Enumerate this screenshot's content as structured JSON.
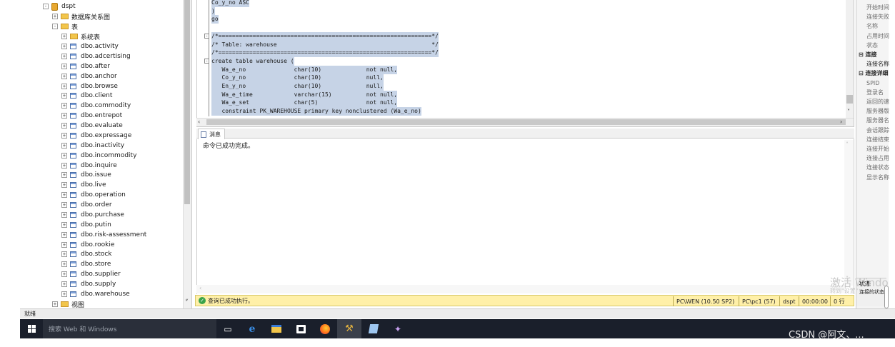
{
  "explorer": {
    "database": "dspt",
    "db_diagrams": "数据库关系图",
    "tables_folder": "表",
    "system_tables": "系统表",
    "tables": [
      "dbo.activity",
      "dbo.adcertising",
      "dbo.after",
      "dbo.anchor",
      "dbo.browse",
      "dbo.client",
      "dbo.commodity",
      "dbo.entrepot",
      "dbo.evaluate",
      "dbo.expressage",
      "dbo.inactivity",
      "dbo.incommodity",
      "dbo.inquire",
      "dbo.issue",
      "dbo.live",
      "dbo.operation",
      "dbo.order",
      "dbo.purchase",
      "dbo.putin",
      "dbo.risk-assessment",
      "dbo.rookie",
      "dbo.stock",
      "dbo.store",
      "dbo.supplier",
      "dbo.supply",
      "dbo.warehouse"
    ],
    "views_folder": "视图"
  },
  "editor": {
    "lines": [
      "Co_y_no ASC",
      ")",
      "go",
      "",
      "/*==============================================================*/",
      "/* Table: warehouse                                             */",
      "/*==============================================================*/",
      "create table warehouse (",
      "   Wa_e_no              char(10)             not null,",
      "   Co_y_no              char(10)             null,",
      "   En_y_no              char(10)             null,",
      "   Wa_e_time            varchar(15)          not null,",
      "   Wa_e_set             char(5)              not null,",
      "   constraint PK_WAREHOUSE primary key nonclustered (Wa_e_no)"
    ]
  },
  "messages": {
    "tab_label": "消息",
    "text": "命令已成功完成。"
  },
  "statusbar": {
    "message": "查询已成功执行。",
    "server": "PC\\WEN (10.50 SP2)",
    "user": "PC\\pc1 (57)",
    "database": "dspt",
    "elapsed": "00:00:00",
    "rows": "0 行"
  },
  "properties": {
    "items": [
      {
        "text": "开始时间",
        "kind": "item"
      },
      {
        "text": "连接失败",
        "kind": "item"
      },
      {
        "text": "名称",
        "kind": "item"
      },
      {
        "text": "占用时间",
        "kind": "item"
      },
      {
        "text": "状态",
        "kind": "item"
      },
      {
        "text": "连接",
        "kind": "header"
      },
      {
        "text": "连接名称",
        "kind": "dark"
      },
      {
        "text": "连接详细",
        "kind": "header"
      },
      {
        "text": "SPID",
        "kind": "item"
      },
      {
        "text": "登录名",
        "kind": "item"
      },
      {
        "text": "返回的速",
        "kind": "item"
      },
      {
        "text": "服务器版",
        "kind": "item"
      },
      {
        "text": "服务器名",
        "kind": "item"
      },
      {
        "text": "会话跟踪",
        "kind": "item"
      },
      {
        "text": "连接结束",
        "kind": "item"
      },
      {
        "text": "连接开始",
        "kind": "item"
      },
      {
        "text": "连接占用",
        "kind": "item"
      },
      {
        "text": "连接状态",
        "kind": "item"
      },
      {
        "text": "显示名称",
        "kind": "item"
      }
    ],
    "footer_title": "状态",
    "footer_desc": "连接的状态",
    "watermark_big": "激活 Windo",
    "watermark_small": "转到\"设置\""
  },
  "app_status": "就绪",
  "taskbar": {
    "search_placeholder": "搜索 Web 和 Windows",
    "watermark": "CSDN @阿文、..."
  },
  "colors": {
    "selection": "#c6d3e6",
    "statusbar": "#fff0a8",
    "taskbar": "#1a1f2b"
  }
}
